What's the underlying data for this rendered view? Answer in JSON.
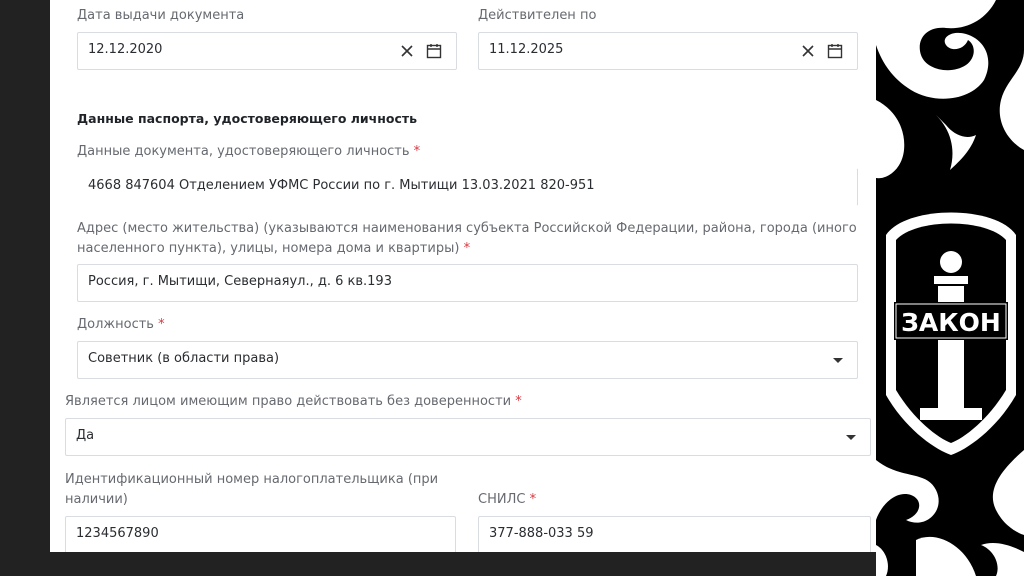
{
  "dates": {
    "issue": {
      "label": "Дата выдачи документа",
      "value": "12.12.2020",
      "clear_icon": "close-icon",
      "calendar_icon": "calendar-icon"
    },
    "valid": {
      "label": "Действителен по",
      "value": "11.12.2025",
      "clear_icon": "close-icon",
      "calendar_icon": "calendar-icon"
    }
  },
  "passport": {
    "section_title": "Данные паспорта, удостоверяющего личность",
    "doc_label": "Данные документа, удостоверяющего личность",
    "doc_value": "4668 847604 Отделением УФМС России по г. Мытищи 13.03.2021 820-951",
    "address_label_line1": "Адрес (место жительства) (указываются наименования субъекта Российской Федерации, района, города (иного",
    "address_label_line2": "населенного пункта), улицы, номера дома и квартиры)",
    "address_value": "Россия, г. Мытищи, Севернаяул., д. 6 кв.193"
  },
  "position": {
    "label": "Должность",
    "value": "Советник (в области права)"
  },
  "authority": {
    "label": "Является лицом имеющим право действовать без доверенности",
    "value": "Да"
  },
  "inn": {
    "label_line1": "Идентификационный номер налогоплательщика (при",
    "label_line2": "наличии)",
    "value": "1234567890"
  },
  "snils": {
    "label": "СНИЛС",
    "value": "377-888-033 59"
  },
  "required_mark": "*",
  "logo": {
    "text": "ЗАКОН"
  },
  "colors": {
    "required": "#d9363e",
    "border": "#d9dce1",
    "label": "#666a70",
    "backdrop": "#222222"
  }
}
